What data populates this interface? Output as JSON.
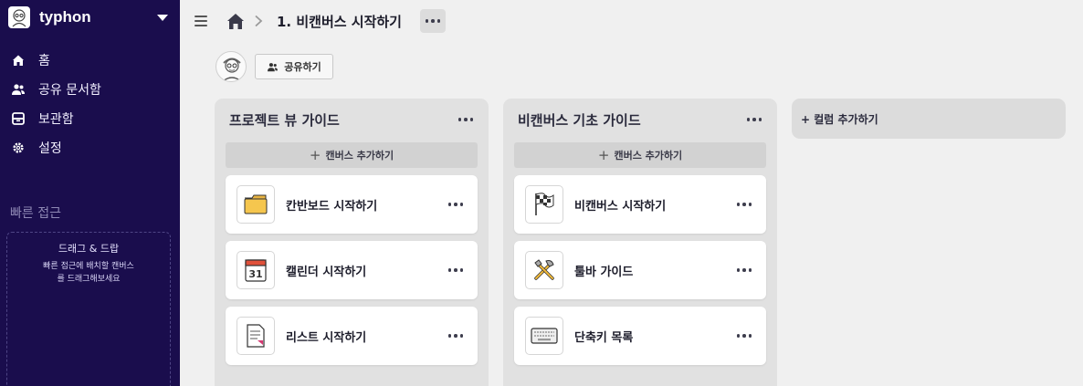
{
  "workspace": {
    "name": "typhon"
  },
  "nav": {
    "items": [
      {
        "label": "홈",
        "icon": "home-icon"
      },
      {
        "label": "공유 문서함",
        "icon": "people-icon"
      },
      {
        "label": "보관함",
        "icon": "archive-icon"
      },
      {
        "label": "설정",
        "icon": "gear-icon"
      }
    ]
  },
  "quick_access": {
    "title": "빠른 접근",
    "dropzone_title": "드래그 & 드랍",
    "dropzone_desc": "빠른 접근에 배치할 캔버스를 드래그해보세요"
  },
  "header": {
    "breadcrumb_icon": "home-icon",
    "title": "1. 비캔버스 시작하기"
  },
  "share": {
    "label": "공유하기"
  },
  "columns": [
    {
      "title": "프로젝트 뷰 가이드",
      "add_canvas": "캔버스 추가하기",
      "cards": [
        {
          "label": "칸반보드 시작하기",
          "icon": "folder-icon"
        },
        {
          "label": "캘린더 시작하기",
          "icon": "calendar-icon"
        },
        {
          "label": "리스트 시작하기",
          "icon": "document-icon"
        }
      ]
    },
    {
      "title": "비캔버스 기초 가이드",
      "add_canvas": "캔버스 추가하기",
      "cards": [
        {
          "label": "비캔버스 시작하기",
          "icon": "checkered-flag-icon"
        },
        {
          "label": "툴바 가이드",
          "icon": "tools-icon"
        },
        {
          "label": "단축키 목록",
          "icon": "keyboard-icon"
        }
      ]
    }
  ],
  "add_column": {
    "label": "+ 컬럼 추가하기"
  }
}
